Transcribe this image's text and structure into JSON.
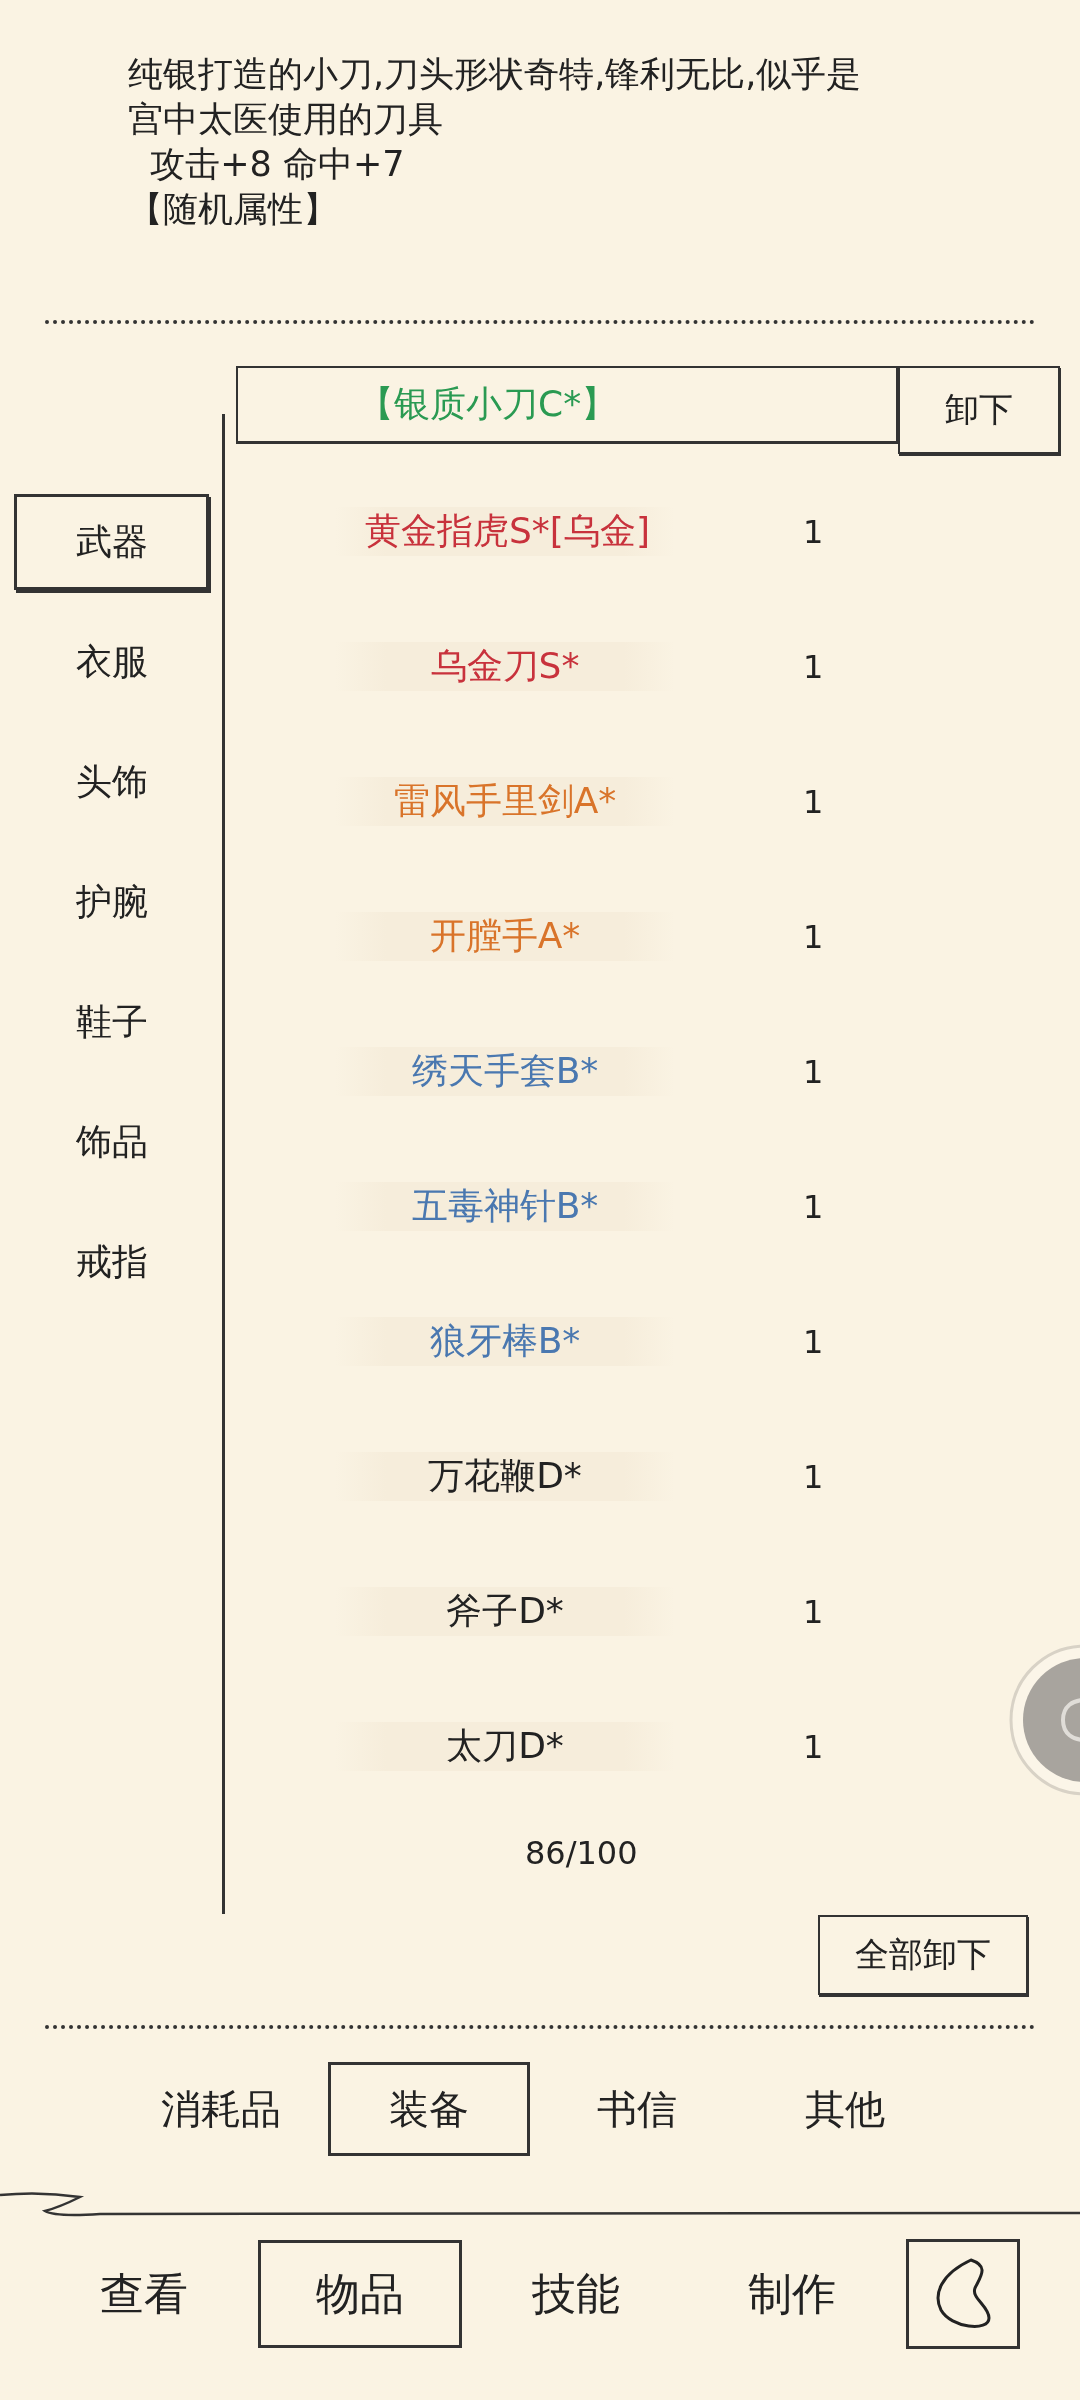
{
  "description": {
    "lines": [
      "纯银打造的小刀,刀头形状奇特,锋利无比,似乎是",
      "宫中太医使用的刀具",
      "  攻击+8 命中+7",
      "【随机属性】"
    ]
  },
  "equipped": {
    "name": "【银质小刀C*】",
    "button": "卸下"
  },
  "categories": [
    {
      "label": "武器",
      "selected": true
    },
    {
      "label": "衣服",
      "selected": false
    },
    {
      "label": "头饰",
      "selected": false
    },
    {
      "label": "护腕",
      "selected": false
    },
    {
      "label": "鞋子",
      "selected": false
    },
    {
      "label": "饰品",
      "selected": false
    },
    {
      "label": "戒指",
      "selected": false
    }
  ],
  "items": [
    {
      "name": "黄金指虎S*[乌金]",
      "count": "1",
      "color": "#c8323c"
    },
    {
      "name": "乌金刀S*",
      "count": "1",
      "color": "#c8323c"
    },
    {
      "name": "雷风手里剑A*",
      "count": "1",
      "color": "#d9742a"
    },
    {
      "name": "开膛手A*",
      "count": "1",
      "color": "#d9742a"
    },
    {
      "name": "绣天手套B*",
      "count": "1",
      "color": "#4a78b0"
    },
    {
      "name": "五毒神针B*",
      "count": "1",
      "color": "#4a78b0"
    },
    {
      "name": "狼牙棒B*",
      "count": "1",
      "color": "#4a78b0"
    },
    {
      "name": "万花鞭D*",
      "count": "1",
      "color": "#222222"
    },
    {
      "name": "斧子D*",
      "count": "1",
      "color": "#222222"
    },
    {
      "name": "太刀D*",
      "count": "1",
      "color": "#222222"
    }
  ],
  "capacity": "86/100",
  "unequip_all": "全部卸下",
  "bag_tabs": [
    {
      "label": "消耗品",
      "selected": false
    },
    {
      "label": "装备",
      "selected": true
    },
    {
      "label": "书信",
      "selected": false
    },
    {
      "label": "其他",
      "selected": false
    }
  ],
  "nav": [
    {
      "label": "查看",
      "selected": false
    },
    {
      "label": "物品",
      "selected": true
    },
    {
      "label": "技能",
      "selected": false
    },
    {
      "label": "制作",
      "selected": false
    }
  ]
}
